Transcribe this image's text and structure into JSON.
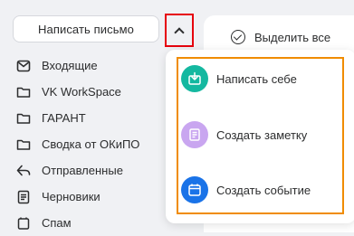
{
  "compose": {
    "label": "Написать письмо"
  },
  "toolbar": {
    "select_all_label": "Выделить все"
  },
  "folders": [
    {
      "label": "Входящие",
      "icon": "inbox-icon"
    },
    {
      "label": "VK WorkSpace",
      "icon": "folder-icon"
    },
    {
      "label": "ГАРАНТ",
      "icon": "folder-icon"
    },
    {
      "label": "Сводка от ОКиПО",
      "icon": "folder-icon"
    },
    {
      "label": "Отправленные",
      "icon": "send-icon"
    },
    {
      "label": "Черновики",
      "icon": "draft-icon"
    },
    {
      "label": "Спам",
      "icon": "spam-icon"
    }
  ],
  "compose_menu": {
    "items": [
      {
        "label": "Написать себе",
        "icon": "mail-self-icon",
        "color": "#14b8a0"
      },
      {
        "label": "Создать заметку",
        "icon": "note-icon",
        "color": "#c9a6f0"
      },
      {
        "label": "Создать событие",
        "icon": "calendar-icon",
        "color": "#1a73e8"
      }
    ]
  },
  "colors": {
    "highlight_red": "#e6000d",
    "highlight_orange": "#f08c00"
  }
}
